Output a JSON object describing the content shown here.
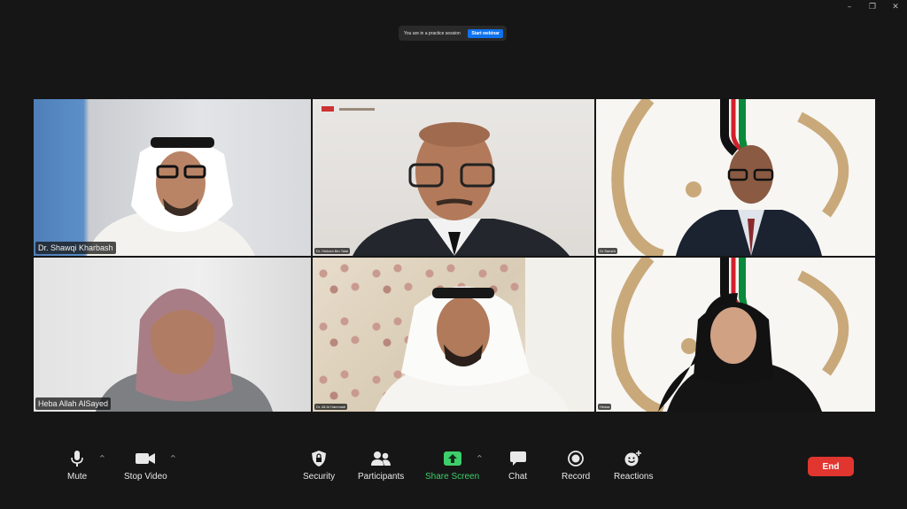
{
  "banner": {
    "text": "You are in a practice session",
    "button": "Start webinar"
  },
  "participants": [
    {
      "name": "Dr. Shawqi Kharbash"
    },
    {
      "name": "Dr. Hisham Bin Talal"
    },
    {
      "name": "Dr Sameh"
    },
    {
      "name": "Heba Allah AlSayed"
    },
    {
      "name": "Dr. Ali Al Hammadi"
    },
    {
      "name": "Hessa"
    }
  ],
  "toolbar": {
    "mute": "Mute",
    "stop_video": "Stop Video",
    "security": "Security",
    "participants": "Participants",
    "share_screen": "Share Screen",
    "chat": "Chat",
    "record": "Record",
    "reactions": "Reactions",
    "end": "End"
  },
  "colors": {
    "end": "#e0362f",
    "share": "#3ccf6b",
    "accent": "#0e72ed"
  }
}
